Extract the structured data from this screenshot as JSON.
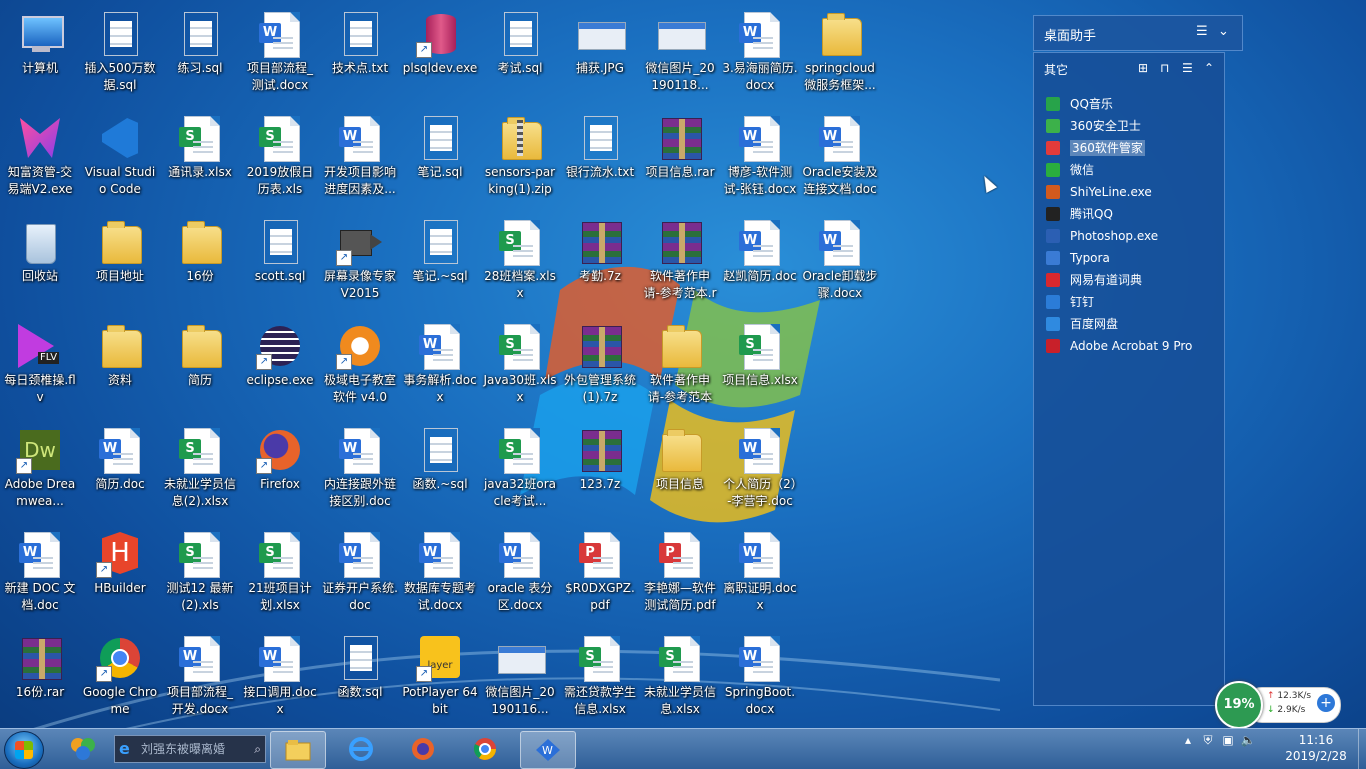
{
  "desktop": {
    "icons": [
      {
        "label": "计算机",
        "type": "computer"
      },
      {
        "label": "插入500万数据.sql",
        "type": "txt"
      },
      {
        "label": "练习.sql",
        "type": "txt"
      },
      {
        "label": "项目部流程_测试.docx",
        "type": "word"
      },
      {
        "label": "技术点.txt",
        "type": "txt"
      },
      {
        "label": "plsqldev.exe",
        "type": "db"
      },
      {
        "label": "考试.sql",
        "type": "txt"
      },
      {
        "label": "捕获.JPG",
        "type": "image"
      },
      {
        "label": "微信图片_20190118...",
        "type": "image"
      },
      {
        "label": "3.易海丽简历.docx",
        "type": "word"
      },
      {
        "label": "springcloud微服务框架...",
        "type": "folder"
      },
      {
        "label": "知富资管-交易端V2.exe",
        "type": "app-pink"
      },
      {
        "label": "Visual Studio Code",
        "type": "vscode"
      },
      {
        "label": "通讯录.xlsx",
        "type": "excel"
      },
      {
        "label": "2019放假日历表.xls",
        "type": "excel"
      },
      {
        "label": "开发项目影响进度因素及...",
        "type": "word"
      },
      {
        "label": "笔记.sql",
        "type": "txt"
      },
      {
        "label": "sensors-parking(1).zip",
        "type": "zip"
      },
      {
        "label": "银行流水.txt",
        "type": "txt"
      },
      {
        "label": "项目信息.rar",
        "type": "rar"
      },
      {
        "label": "博彦-软件测试-张钰.docx",
        "type": "word"
      },
      {
        "label": "Oracle安装及连接文档.doc",
        "type": "word"
      },
      {
        "label": "回收站",
        "type": "recycle"
      },
      {
        "label": "项目地址",
        "type": "folder"
      },
      {
        "label": "16份",
        "type": "folder"
      },
      {
        "label": "scott.sql",
        "type": "txt"
      },
      {
        "label": "屏幕录像专家V2015",
        "type": "camera"
      },
      {
        "label": "笔记.~sql",
        "type": "txt"
      },
      {
        "label": "28班档案.xlsx",
        "type": "excel"
      },
      {
        "label": "考勤.7z",
        "type": "rar"
      },
      {
        "label": "软件著作申请-参考范本.rar",
        "type": "rar"
      },
      {
        "label": "赵凯简历.doc",
        "type": "word"
      },
      {
        "label": "Oracle卸载步骤.docx",
        "type": "word"
      },
      {
        "label": "每日颈椎操.flv",
        "type": "flv"
      },
      {
        "label": "资料",
        "type": "folder"
      },
      {
        "label": "简历",
        "type": "folder"
      },
      {
        "label": "eclipse.exe",
        "type": "eclipse"
      },
      {
        "label": "极域电子教室软件 v4.0 2...",
        "type": "orange-app"
      },
      {
        "label": "事务解析.docx",
        "type": "word"
      },
      {
        "label": "Java30班.xlsx",
        "type": "excel"
      },
      {
        "label": "外包管理系统(1).7z",
        "type": "rar"
      },
      {
        "label": "软件著作申请-参考范本",
        "type": "folder"
      },
      {
        "label": "项目信息.xlsx",
        "type": "excel"
      },
      {
        "label": "Adobe Dreamwea...",
        "type": "dw"
      },
      {
        "label": "简历.doc",
        "type": "word"
      },
      {
        "label": "未就业学员信息(2).xlsx",
        "type": "excel"
      },
      {
        "label": "Firefox",
        "type": "firefox"
      },
      {
        "label": "内连接跟外链接区别.doc",
        "type": "word"
      },
      {
        "label": "函数.~sql",
        "type": "txt"
      },
      {
        "label": "java32班oracle考试...",
        "type": "excel"
      },
      {
        "label": "123.7z",
        "type": "rar"
      },
      {
        "label": "项目信息",
        "type": "folder"
      },
      {
        "label": "个人简历（2）-李营宇.doc",
        "type": "word"
      },
      {
        "label": "新建 DOC 文档.doc",
        "type": "word"
      },
      {
        "label": "HBuilder",
        "type": "hbuilder"
      },
      {
        "label": "测试12 最新(2).xls",
        "type": "excel"
      },
      {
        "label": "21班项目计划.xlsx",
        "type": "excel"
      },
      {
        "label": "证券开户系统.doc",
        "type": "word"
      },
      {
        "label": "数据库专题考试.docx",
        "type": "word"
      },
      {
        "label": "oracle 表分区.docx",
        "type": "word"
      },
      {
        "label": "$R0DXGPZ.pdf",
        "type": "pdf"
      },
      {
        "label": "李艳娜—软件测试简历.pdf",
        "type": "pdf"
      },
      {
        "label": "离职证明.docx",
        "type": "word"
      },
      {
        "label": "16份.rar",
        "type": "rar"
      },
      {
        "label": "Google Chrome",
        "type": "chrome"
      },
      {
        "label": "项目部流程_开发.docx",
        "type": "word"
      },
      {
        "label": "接口调用.docx",
        "type": "word"
      },
      {
        "label": "函数.sql",
        "type": "txt"
      },
      {
        "label": "PotPlayer 64 bit",
        "type": "potplayer"
      },
      {
        "label": "微信图片_20190116...",
        "type": "image"
      },
      {
        "label": "需还贷款学生信息.xlsx",
        "type": "excel"
      },
      {
        "label": "未就业学员信息.xlsx",
        "type": "excel"
      },
      {
        "label": "SpringBoot.docx",
        "type": "word"
      }
    ]
  },
  "gadget": {
    "title": "桌面助手",
    "section": "其它",
    "items": [
      {
        "label": "QQ音乐",
        "color": "#27a34a"
      },
      {
        "label": "360安全卫士",
        "color": "#3cb14a"
      },
      {
        "label": "360软件管家",
        "color": "#e23b3b",
        "selected": true
      },
      {
        "label": "微信",
        "color": "#2aae3e"
      },
      {
        "label": "ShiYeLine.exe",
        "color": "#d25a1e"
      },
      {
        "label": "腾讯QQ",
        "color": "#222222"
      },
      {
        "label": "Photoshop.exe",
        "color": "#2b5fb3"
      },
      {
        "label": "Typora",
        "color": "#3a7bd5"
      },
      {
        "label": "网易有道词典",
        "color": "#d8282f"
      },
      {
        "label": "钉钉",
        "color": "#2b7cd8"
      },
      {
        "label": "百度网盘",
        "color": "#2f8ae0"
      },
      {
        "label": "Adobe Acrobat 9 Pro",
        "color": "#c8202a"
      }
    ]
  },
  "meter": {
    "percent": "19%",
    "up": "12.3K/s",
    "down": "2.9K/s"
  },
  "taskbar": {
    "search_placeholder": "刘强东被曝离婚",
    "time": "11:16",
    "date": "2019/2/28"
  },
  "colors": {
    "taskbar": "#2f5f98",
    "desktop": "#1a6fc0",
    "gadget": "#164e96"
  }
}
